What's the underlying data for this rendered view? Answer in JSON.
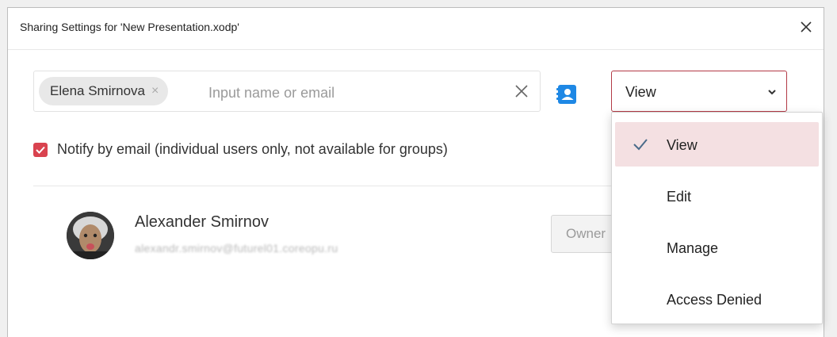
{
  "dialog": {
    "title": "Sharing Settings for 'New Presentation.xodp'"
  },
  "share_input": {
    "chip_label": "Elena Smirnova",
    "chip_remove_glyph": "×",
    "placeholder": "Input name or email",
    "value": ""
  },
  "permission": {
    "selected": "View",
    "options": [
      {
        "label": "View",
        "selected": true
      },
      {
        "label": "Edit",
        "selected": false
      },
      {
        "label": "Manage",
        "selected": false
      },
      {
        "label": "Access Denied",
        "selected": false
      }
    ]
  },
  "notify": {
    "checked": true,
    "label": "Notify by email (individual users only, not available for groups)"
  },
  "users": [
    {
      "name": "Alexander Smirnov",
      "email": "alexandr.smirnov@futurel01.coreopu.ru",
      "role": "Owner"
    }
  ],
  "icons": {
    "close": "close-icon",
    "clear": "clear-icon",
    "address_book": "address-book-icon",
    "chevron": "chevron-down-icon",
    "check": "checkmark-icon"
  },
  "colors": {
    "accent": "#d9434f",
    "select_border": "#b33a46",
    "selected_item_bg": "#f4e0e2",
    "addressbook_blue": "#1e88e5"
  }
}
